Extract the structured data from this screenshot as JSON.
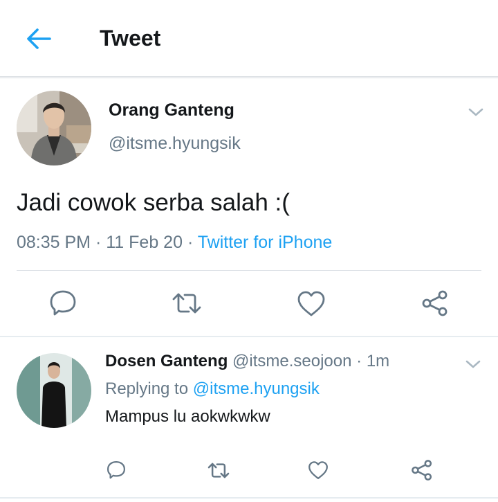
{
  "header": {
    "title": "Tweet",
    "back_icon": "arrow-left-icon"
  },
  "tweet": {
    "author_name": "Orang Ganteng",
    "author_handle": "@itsme.hyungsik",
    "text": "Jadi cowok serba salah :(",
    "time": "08:35 PM",
    "sep1": "·",
    "date": "11 Feb 20",
    "sep2": "·",
    "source": "Twitter for iPhone"
  },
  "reply": {
    "author_name": "Dosen Ganteng",
    "author_handle": "@itsme.seojoon",
    "sep": "·",
    "time_ago": "1m",
    "replying_prefix": "Replying to",
    "replying_handle": "@itsme.hyungsik",
    "text": "Mampus lu aokwkwkw"
  },
  "colors": {
    "accent": "#1da1f2",
    "muted": "#657786",
    "text": "#14171a",
    "icon": "#657786"
  }
}
